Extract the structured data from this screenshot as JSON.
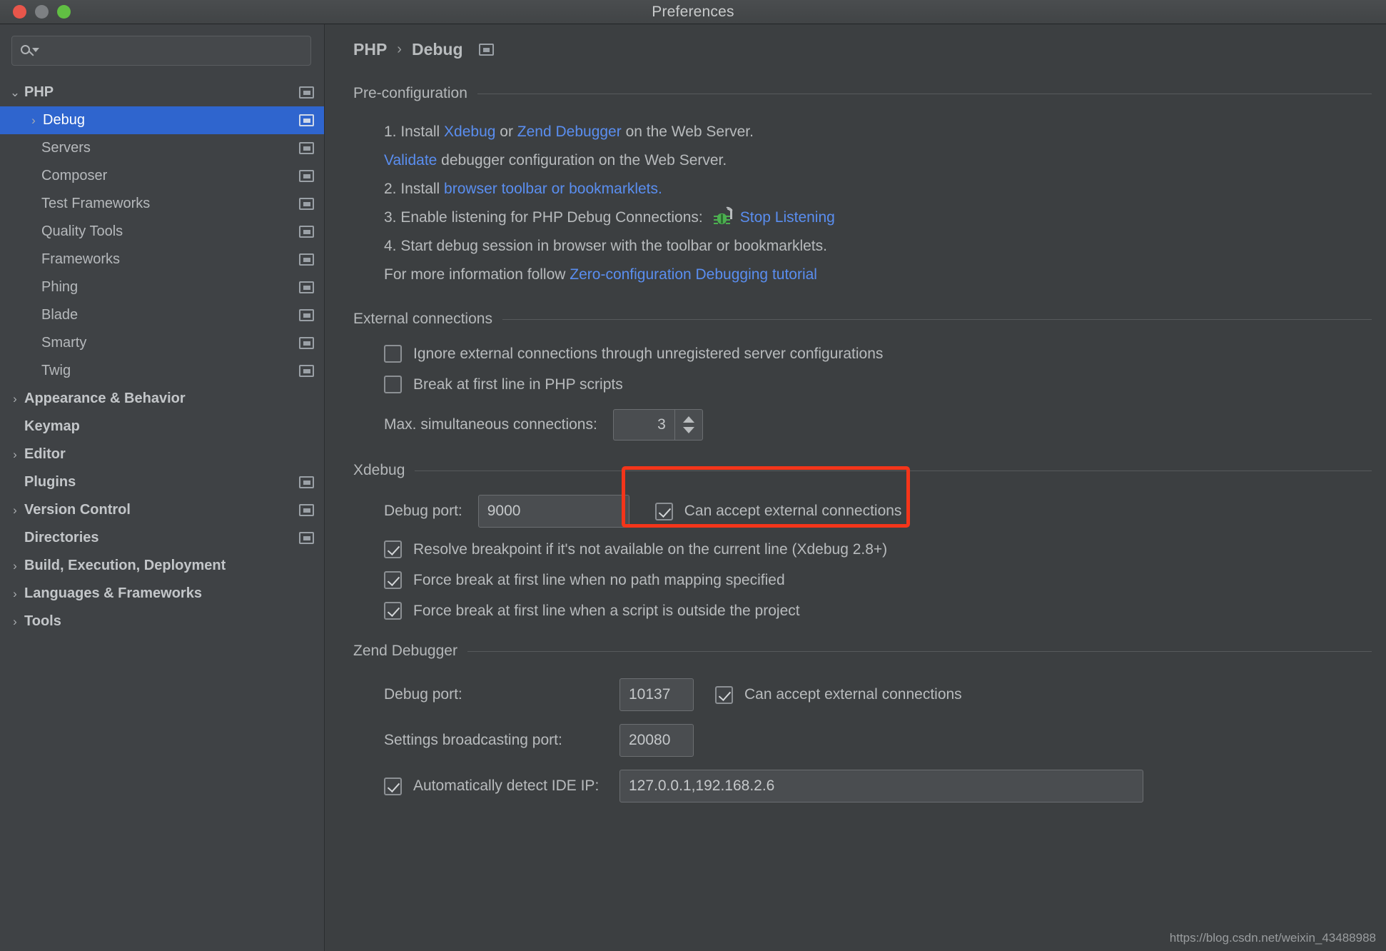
{
  "window": {
    "title": "Preferences",
    "traffic_lights": [
      "close-button",
      "minimize-button",
      "zoom-button"
    ]
  },
  "search": {
    "placeholder": "",
    "value": ""
  },
  "sidebar": {
    "items": [
      {
        "label": "PHP",
        "arrow": "⌄",
        "indent": 0,
        "bold": true,
        "gadget": true,
        "selected": false
      },
      {
        "label": "Debug",
        "arrow": "›",
        "indent": 1,
        "bold": false,
        "gadget": true,
        "selected": true
      },
      {
        "label": "Servers",
        "arrow": "",
        "indent": 1,
        "bold": false,
        "gadget": true,
        "selected": false
      },
      {
        "label": "Composer",
        "arrow": "",
        "indent": 1,
        "bold": false,
        "gadget": true,
        "selected": false
      },
      {
        "label": "Test Frameworks",
        "arrow": "",
        "indent": 1,
        "bold": false,
        "gadget": true,
        "selected": false
      },
      {
        "label": "Quality Tools",
        "arrow": "",
        "indent": 1,
        "bold": false,
        "gadget": true,
        "selected": false
      },
      {
        "label": "Frameworks",
        "arrow": "",
        "indent": 1,
        "bold": false,
        "gadget": true,
        "selected": false
      },
      {
        "label": "Phing",
        "arrow": "",
        "indent": 1,
        "bold": false,
        "gadget": true,
        "selected": false
      },
      {
        "label": "Blade",
        "arrow": "",
        "indent": 1,
        "bold": false,
        "gadget": true,
        "selected": false
      },
      {
        "label": "Smarty",
        "arrow": "",
        "indent": 1,
        "bold": false,
        "gadget": true,
        "selected": false
      },
      {
        "label": "Twig",
        "arrow": "",
        "indent": 1,
        "bold": false,
        "gadget": true,
        "selected": false
      },
      {
        "label": "Appearance & Behavior",
        "arrow": "›",
        "indent": 0,
        "bold": true,
        "gadget": false,
        "selected": false
      },
      {
        "label": "Keymap",
        "arrow": "",
        "indent": 0,
        "bold": true,
        "gadget": false,
        "selected": false
      },
      {
        "label": "Editor",
        "arrow": "›",
        "indent": 0,
        "bold": true,
        "gadget": false,
        "selected": false
      },
      {
        "label": "Plugins",
        "arrow": "",
        "indent": 0,
        "bold": true,
        "gadget": true,
        "selected": false
      },
      {
        "label": "Version Control",
        "arrow": "›",
        "indent": 0,
        "bold": true,
        "gadget": true,
        "selected": false
      },
      {
        "label": "Directories",
        "arrow": "",
        "indent": 0,
        "bold": true,
        "gadget": true,
        "selected": false
      },
      {
        "label": "Build, Execution, Deployment",
        "arrow": "›",
        "indent": 0,
        "bold": true,
        "gadget": false,
        "selected": false
      },
      {
        "label": "Languages & Frameworks",
        "arrow": "›",
        "indent": 0,
        "bold": true,
        "gadget": false,
        "selected": false
      },
      {
        "label": "Tools",
        "arrow": "›",
        "indent": 0,
        "bold": true,
        "gadget": false,
        "selected": false
      }
    ]
  },
  "breadcrumb": {
    "root": "PHP",
    "separator": "›",
    "current": "Debug"
  },
  "preconfiguration": {
    "title": "Pre-configuration",
    "step1_prefix": "1. Install ",
    "step1_link1": "Xdebug",
    "step1_mid": " or ",
    "step1_link2": "Zend Debugger",
    "step1_suffix": " on the Web Server.",
    "step1_sub_link": "Validate",
    "step1_sub_suffix": " debugger configuration on the Web Server.",
    "step2_prefix": "2. Install ",
    "step2_link": "browser toolbar or bookmarklets.",
    "step3_prefix": "3. Enable listening for PHP Debug Connections:",
    "step3_link": "Stop Listening",
    "step4": "4. Start debug session in browser with the toolbar or bookmarklets.",
    "step4_sub_prefix": "For more information follow ",
    "step4_sub_link": "Zero-configuration Debugging tutorial"
  },
  "external_connections": {
    "title": "External connections",
    "ignore_label": "Ignore external connections through unregistered server configurations",
    "ignore_checked": false,
    "break_label": "Break at first line in PHP scripts",
    "break_checked": false,
    "max_conn_label": "Max. simultaneous connections:",
    "max_conn_value": "3"
  },
  "xdebug": {
    "title": "Xdebug",
    "debug_port_label": "Debug port:",
    "debug_port_value": "9000",
    "can_accept_label": "Can accept external connections",
    "can_accept_checked": true,
    "resolve_label": "Resolve breakpoint if it's not available on the current line (Xdebug 2.8+)",
    "resolve_checked": true,
    "force_nopath_label": "Force break at first line when no path mapping specified",
    "force_nopath_checked": true,
    "force_outside_label": "Force break at first line when a script is outside the project",
    "force_outside_checked": true
  },
  "zend_debugger": {
    "title": "Zend Debugger",
    "debug_port_label": "Debug port:",
    "debug_port_value": "10137",
    "can_accept_label": "Can accept external connections",
    "can_accept_checked": true,
    "broadcast_label": "Settings broadcasting port:",
    "broadcast_value": "20080",
    "auto_ip_label": "Automatically detect IDE IP:",
    "auto_ip_checked": true,
    "auto_ip_value": "127.0.0.1,192.168.2.6"
  },
  "annotation": {
    "highlight_color": "#f4351a"
  },
  "watermark": {
    "text": "https://blog.csdn.net/weixin_43488988"
  }
}
